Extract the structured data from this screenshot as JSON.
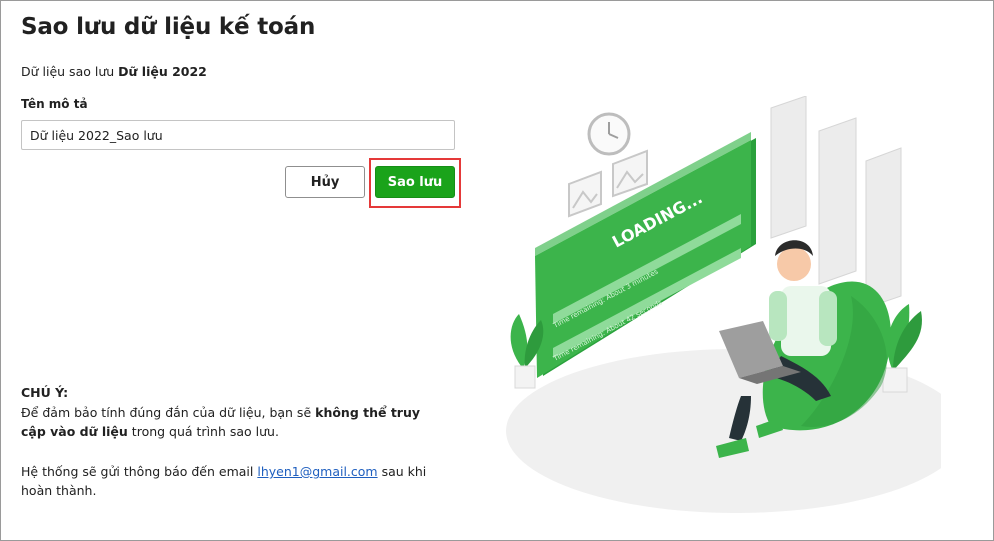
{
  "page": {
    "title": "Sao lưu dữ liệu kế toán",
    "subtitle_prefix": "Dữ liệu sao lưu",
    "subtitle_dataset": "Dữ liệu 2022"
  },
  "form": {
    "description_label": "Tên mô tả",
    "description_value": "Dữ liệu 2022_Sao lưu"
  },
  "actions": {
    "cancel_label": "Hủy",
    "save_label": "Sao lưu",
    "save_color": "#1aa31a",
    "highlight_color": "#e53939"
  },
  "notice": {
    "heading": "CHÚ Ý:",
    "text_before": "Để đảm bảo tính đúng đắn của dữ liệu, bạn sẽ",
    "text_bold": "không thể truy cập vào dữ liệu",
    "text_after": "trong quá trình sao lưu.",
    "email_before": "Hệ thống sẽ gửi thông báo đến email",
    "email": "lhyen1@gmail.com",
    "email_after": "sau khi hoàn thành."
  },
  "illustration": {
    "loading_text": "LOADING...",
    "line1": "Time remaining: About 3 minutes",
    "line2": "Time remaining: About 42 seconds",
    "accent": "#3cb44b"
  }
}
